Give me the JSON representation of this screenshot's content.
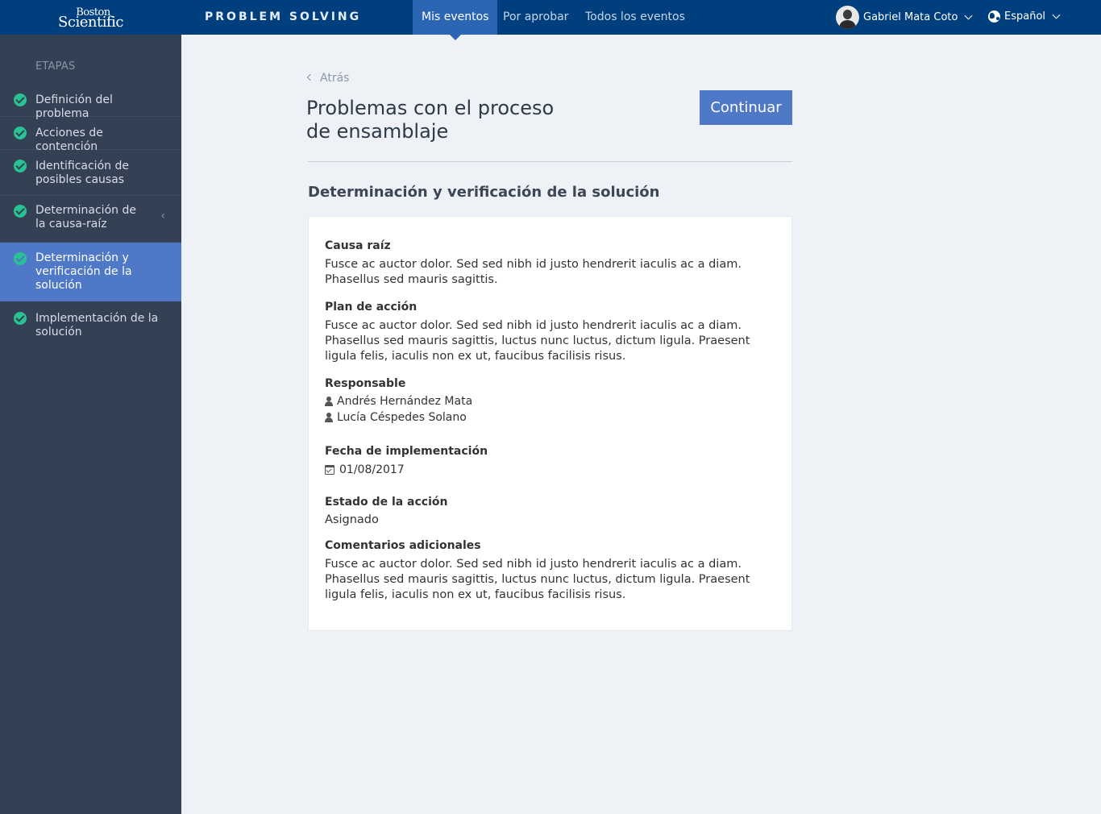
{
  "brand": {
    "line1": "Boston",
    "line2": "Scientific"
  },
  "app_title": "PROBLEM SOLVING",
  "nav": {
    "tabs": [
      {
        "label": "Mis eventos",
        "active": true
      },
      {
        "label": "Por aprobar",
        "active": false
      },
      {
        "label": "Todos los eventos",
        "active": false
      }
    ]
  },
  "user": {
    "name": "Gabriel Mata Coto"
  },
  "language": {
    "selected": "Español"
  },
  "sidebar": {
    "heading": "ETAPAS",
    "steps": [
      {
        "label": "Definición del problema",
        "completed": true
      },
      {
        "label": "Acciones de contención",
        "completed": true
      },
      {
        "label": "Identificación de posibles causas",
        "completed": true
      },
      {
        "label": "Determinación de la causa-raíz",
        "completed": true
      },
      {
        "label": "Determinación y verificación de la solución",
        "completed": true,
        "active": true
      },
      {
        "label": "Implementación de la solución",
        "completed": true
      }
    ]
  },
  "main": {
    "back_label": "Atrás",
    "title": "Problemas con el proceso de ensamblaje",
    "continue_label": "Continuar",
    "section_title": "Determinación y verificación de la solución",
    "fields": {
      "root_cause": {
        "label": "Causa raíz",
        "value": "Fusce ac auctor dolor. Sed sed nibh id justo hendrerit iaculis ac a diam. Phasellus sed mauris sagittis."
      },
      "action_plan": {
        "label": "Plan de acción",
        "value": "Fusce ac auctor dolor. Sed sed nibh id justo hendrerit iaculis ac a diam. Phasellus sed mauris sagittis, luctus nunc luctus, dictum ligula. Praesent ligula felis, iaculis non ex ut, faucibus facilisis risus."
      },
      "responsible": {
        "label": "Responsable",
        "people": [
          "Andrés Hernández Mata",
          "Lucía Céspedes Solano"
        ]
      },
      "implementation_date": {
        "label": "Fecha de implementación",
        "value": "01/08/2017"
      },
      "action_status": {
        "label": "Estado de la acción",
        "value": "Asignado"
      },
      "comments": {
        "label": "Comentarios adicionales",
        "value": "Fusce ac auctor dolor. Sed sed nibh id justo hendrerit iaculis ac a diam. Phasellus sed mauris sagittis, luctus nunc luctus, dictum ligula. Praesent ligula felis, iaculis non ex ut, faucibus facilisis risus."
      }
    }
  },
  "colors": {
    "topbar": "#003f7d",
    "sidebar": "#344154",
    "accent": "#4f79c7",
    "active_tab": "#2b66b5",
    "check": "#27c393",
    "page_bg": "#eef1f6"
  }
}
